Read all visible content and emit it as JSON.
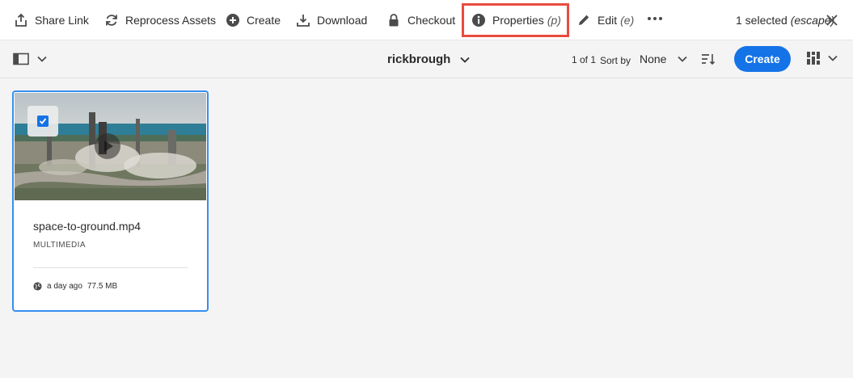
{
  "actions": [
    {
      "label": "Share Link",
      "icon": "share-icon"
    },
    {
      "label": "Reprocess Assets",
      "icon": "reprocess-icon"
    },
    {
      "label": "Create",
      "icon": "add-circle-icon"
    },
    {
      "label": "Download",
      "icon": "download-icon"
    },
    {
      "label": "Checkout",
      "icon": "lock-icon"
    },
    {
      "label": "Properties",
      "shortcut": "(p)",
      "icon": "info-icon",
      "highlighted": true
    },
    {
      "label": "Edit",
      "shortcut": "(e)",
      "icon": "pencil-icon"
    }
  ],
  "selection": {
    "count_text": "1 selected",
    "escape_text": "(escape)"
  },
  "subheader": {
    "folder_title": "rickbrough",
    "paging": "1 of 1",
    "sort_label": "Sort by",
    "sort_value": "None",
    "create_label": "Create"
  },
  "card": {
    "title": "space-to-ground.mp4",
    "type": "MULTIMEDIA",
    "modified": "a day ago",
    "size": "77.5 MB",
    "selected": true
  },
  "colors": {
    "accent": "#1473e6",
    "selection_border": "#378ef0",
    "highlight_box": "#e94c3d"
  }
}
